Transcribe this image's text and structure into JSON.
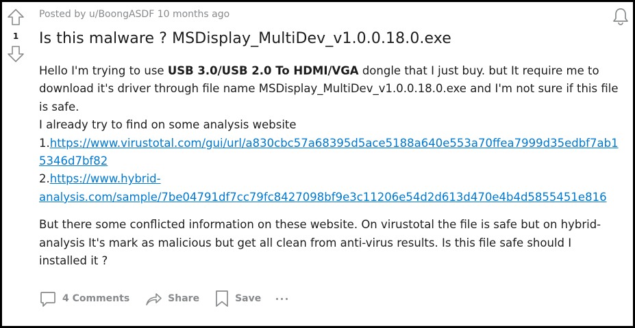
{
  "post": {
    "meta": "Posted by u/BoongASDF 10 months ago",
    "score": "1",
    "title": "Is this malware ? MSDisplay_MultiDev_v1.0.0.18.0.exe",
    "body": {
      "p1_pre": "Hello I'm trying to use ",
      "p1_bold": "USB 3.0/USB 2.0 To HDMI/VGA",
      "p1_post": " dongle that I just buy. but It require me to download it's driver through file name MSDisplay_MultiDev_v1.0.0.18.0.exe and I'm not sure if this file is safe.",
      "p2": "I already try to find on some analysis website",
      "link1_prefix": "1.",
      "link1_text": "https://www.virustotal.com/gui/url/a830cbc57a68395d5ace5188a640e553a70ffea7999d35edbf7ab15346d7bf82",
      "link2_prefix": "2.",
      "link2_text": "https://www.hybrid-analysis.com/sample/7be04791df7cc79fc8427098bf9e3c11206e54d2d613d470e4b4d5855451e816",
      "p3": "But there some conflicted information on these website. On virustotal the file is safe but on hybrid-analysis It's mark as malicious but get all clean from anti-virus results. Is this file safe should I installed it ?"
    },
    "actions": {
      "comments": "4 Comments",
      "share": "Share",
      "save": "Save"
    }
  },
  "icons": [
    "upvote-icon",
    "downvote-icon",
    "bell-icon",
    "comment-icon",
    "share-icon",
    "save-icon",
    "more-icon"
  ],
  "colors": {
    "link": "#0079d3",
    "meta": "#878a8c",
    "text": "#1c1c1c",
    "icon": "#878a8c"
  }
}
